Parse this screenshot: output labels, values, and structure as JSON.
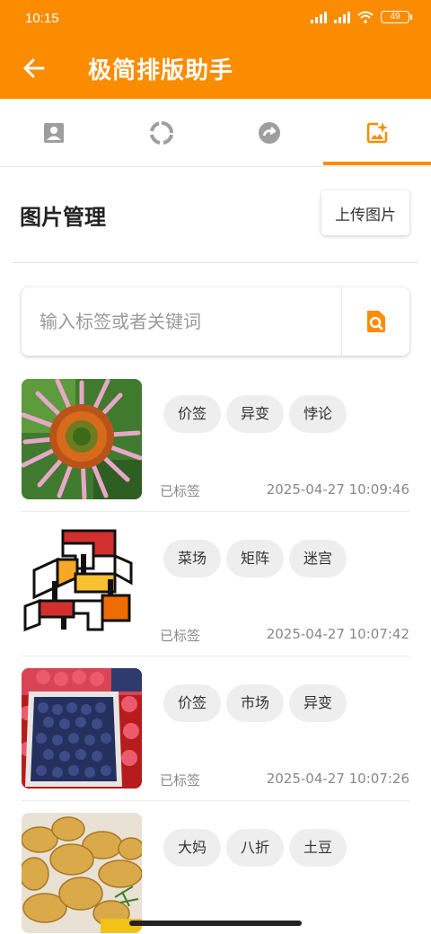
{
  "status_bar": {
    "time": "10:15",
    "battery": "49"
  },
  "app_bar": {
    "title": "极简排版助手",
    "back_icon": "arrow-back-icon"
  },
  "tabs": [
    {
      "icon": "person-icon"
    },
    {
      "icon": "loading-circle-icon"
    },
    {
      "icon": "redo-icon"
    },
    {
      "icon": "image-sparkle-icon",
      "selected": true
    }
  ],
  "section": {
    "title": "图片管理",
    "upload_label": "上传图片"
  },
  "search": {
    "placeholder": "输入标签或者关键词",
    "icon": "image-search-icon"
  },
  "items": [
    {
      "thumb": "flower-photo",
      "tags": [
        "价签",
        "异变",
        "悖论"
      ],
      "status": "已标签",
      "time": "2025-04-27 10:09:46"
    },
    {
      "thumb": "geometric-art",
      "tags": [
        "菜场",
        "矩阵",
        "迷宫"
      ],
      "status": "已标签",
      "time": "2025-04-27 10:07:42"
    },
    {
      "thumb": "berries-photo",
      "tags": [
        "价签",
        "市场",
        "异变"
      ],
      "status": "已标签",
      "time": "2025-04-27 10:07:26"
    },
    {
      "thumb": "potatoes-photo",
      "tags": [
        "大妈",
        "八折",
        "土豆"
      ],
      "status": "",
      "time": ""
    }
  ],
  "colors": {
    "accent": "#fb8c00",
    "tag_bg": "#eeeeee",
    "muted_text": "#888888"
  }
}
